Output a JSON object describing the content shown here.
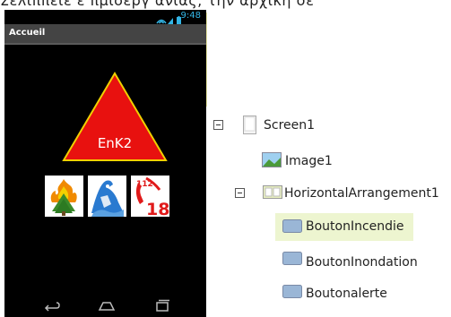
{
  "caption": "Σελιππειε ε πμιοεργ ανιας, την αρχική σε",
  "phone": {
    "status_time": "9:48",
    "title": "Accueil",
    "logo_text": "EnK2",
    "buttons": [
      {
        "name": "bouton-incendie",
        "icon": "fire-icon"
      },
      {
        "name": "bouton-inondation",
        "icon": "flood-icon"
      },
      {
        "name": "bouton-alerte",
        "icon": "phone-alert-icon",
        "label_small": "112",
        "label_big": "18"
      }
    ]
  },
  "tree": {
    "screen": "Screen1",
    "image": "Image1",
    "arrangement": "HorizontalArrangement1",
    "children": [
      "BoutonIncendie",
      "BoutonInondation",
      "Boutonalerte"
    ],
    "selected": "BoutonIncendie"
  },
  "colors": {
    "accent_status": "#33b5e5",
    "triangle": "#e8110f",
    "triangle_border": "#f0d000",
    "selection": "#edf5d0"
  }
}
